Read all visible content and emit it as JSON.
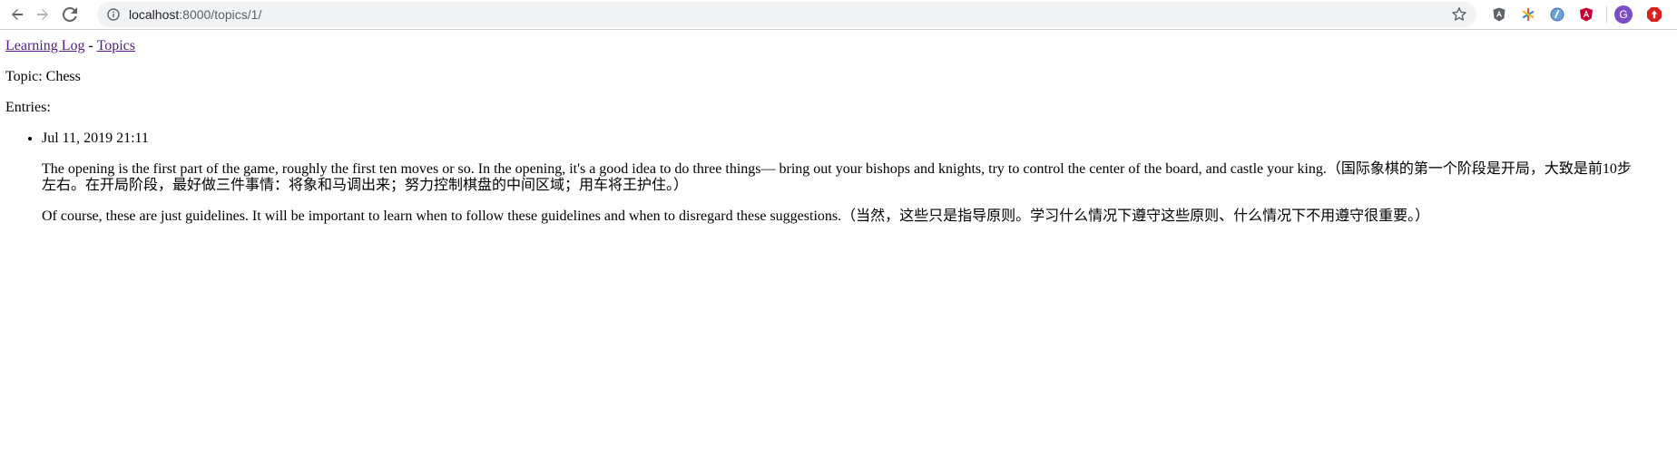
{
  "browser": {
    "url_host": "localhost",
    "url_rest": ":8000/topics/1/",
    "avatar_letter": "G"
  },
  "nav": {
    "home_link": "Learning Log",
    "separator": " - ",
    "topics_link": "Topics"
  },
  "topic": {
    "heading": "Topic: Chess"
  },
  "entries": {
    "label": "Entries:",
    "items": [
      {
        "date": "Jul 11, 2019 21:11",
        "paragraphs": [
          "The opening is the first part of the game, roughly the first ten moves or so. In the opening, it's a good idea to do three things— bring out your bishops and knights, try to control the center of the board, and castle your king.（国际象棋的第一个阶段是开局，大致是前10步左右。在开局阶段，最好做三件事情：将象和马调出来；努力控制棋盘的中间区域；用车将王护住。）",
          "Of course, these are just guidelines. It will be important to learn when to follow these guidelines and when to disregard these suggestions.（当然，这些只是指导原则。学习什么情况下遵守这些原则、什么情况下不用遵守很重要。）"
        ]
      }
    ]
  },
  "colors": {
    "link_visited": "#551a8b",
    "omnibox_bg": "#f1f3f4",
    "avatar_bg": "#7a4fc6"
  },
  "icons": [
    "back-arrow-icon",
    "forward-arrow-icon",
    "reload-icon",
    "info-icon",
    "star-icon",
    "shield-extension-icon",
    "asterisk-extension-icon",
    "globe-extension-icon",
    "angular-extension-icon",
    "adblock-extension-icon"
  ]
}
